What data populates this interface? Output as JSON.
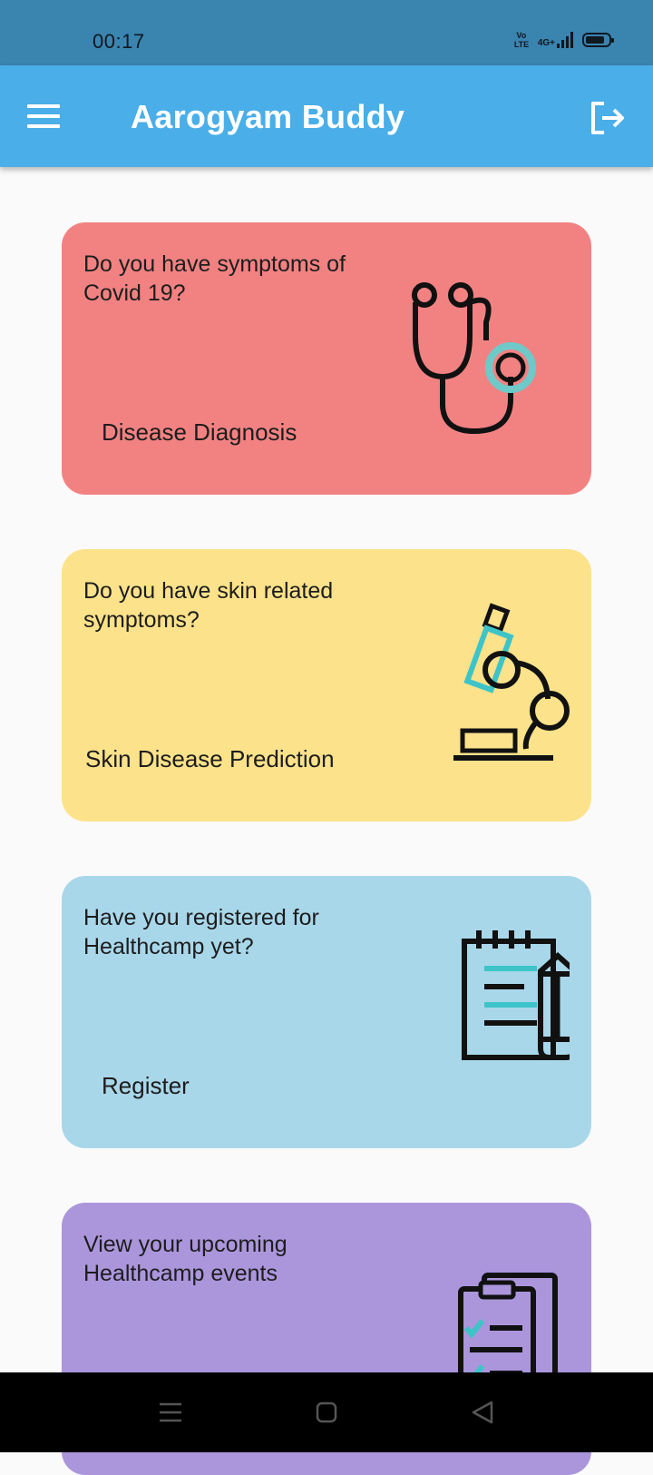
{
  "status_bar": {
    "time": "00:17",
    "volte_line1": "Vo",
    "volte_line2": "LTE",
    "network": "4G+"
  },
  "app_bar": {
    "title": "Aarogyam Buddy",
    "menu_icon": "hamburger-menu-icon",
    "logout_icon": "logout-icon"
  },
  "cards": [
    {
      "question": "Do you have symptoms of Covid 19?",
      "action": "Disease Diagnosis",
      "color": "#f28282",
      "icon": "stethoscope-icon"
    },
    {
      "question": "Do you have skin related symptoms?",
      "action": "Skin Disease Prediction",
      "color": "#fce28a",
      "icon": "microscope-icon"
    },
    {
      "question": "Have you registered for Healthcamp yet?",
      "action": "Register",
      "color": "#a9d7ea",
      "icon": "notepad-pencil-icon"
    },
    {
      "question": "View your upcoming Healthcamp events",
      "action": "",
      "color": "#ab96dc",
      "icon": "clipboard-checklist-icon"
    }
  ],
  "colors": {
    "status_bar": "#3a84b0",
    "app_bar": "#4aaee8",
    "background": "#fafafa",
    "accent_teal": "#3ec4c8"
  },
  "nav": {
    "recents_icon": "recents-icon",
    "home_icon": "home-icon",
    "back_icon": "back-icon"
  }
}
